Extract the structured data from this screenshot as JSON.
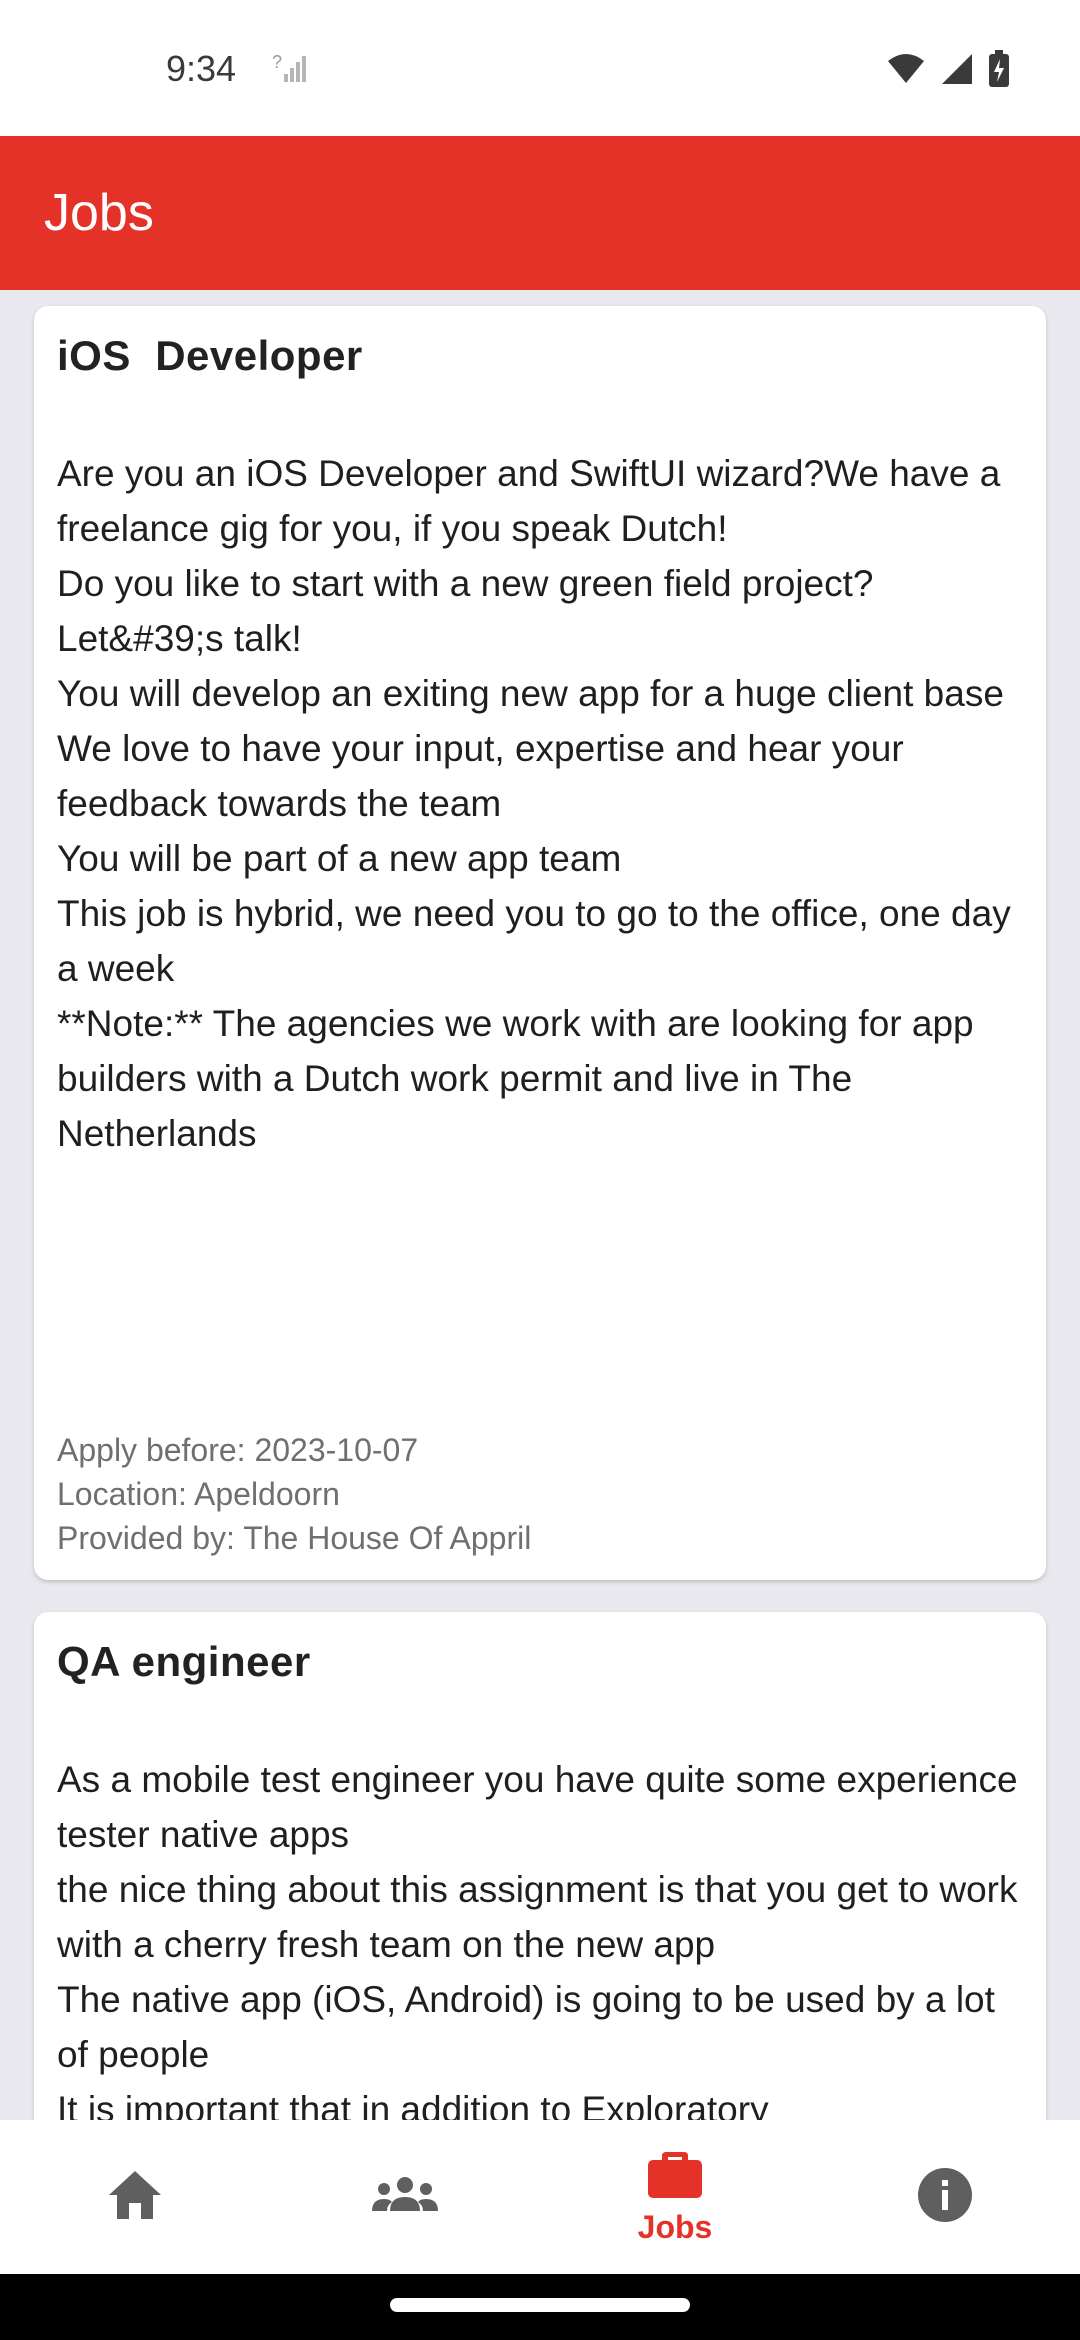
{
  "status": {
    "time": "9:34"
  },
  "app_bar": {
    "title": "Jobs"
  },
  "jobs": [
    {
      "title": "iOS  Developer",
      "description": "Are you an iOS Developer and SwiftUI wizard?We have a freelance gig for you, if you speak Dutch!\nDo you like to start with a new green field project? Let&#39;s talk!\nYou will develop an exiting new app for a huge client base\nWe love to have your input, expertise and hear your feedback towards the team\nYou will be part of a new app team\nThis job is hybrid, we need you to go to the office, one day a week\n**Note:** The agencies we work with are looking for app builders with a Dutch work permit and live in The Netherlands",
      "apply_before": "Apply before: 2023-10-07",
      "location": "Location: Apeldoorn",
      "provider": "Provided by: The House Of Appril"
    },
    {
      "title": "QA engineer",
      "description": "As a mobile test engineer you have quite some experience tester native apps\nthe nice thing about this assignment is that you get to work with a cherry fresh team on the new app\nThe native app (iOS, Android) is going to be used by a lot of people\nIt is important that in addition to Exploratory"
    }
  ],
  "bottom_nav": {
    "items": [
      {
        "icon": "home-icon"
      },
      {
        "icon": "people-icon"
      },
      {
        "icon": "briefcase-icon",
        "label": "Jobs",
        "selected": true
      },
      {
        "icon": "info-icon"
      }
    ],
    "active_color": "#e53228",
    "inactive_color": "#5f5f5f"
  },
  "colors": {
    "app_bar": "#e53228",
    "background": "#e9e8ee"
  }
}
